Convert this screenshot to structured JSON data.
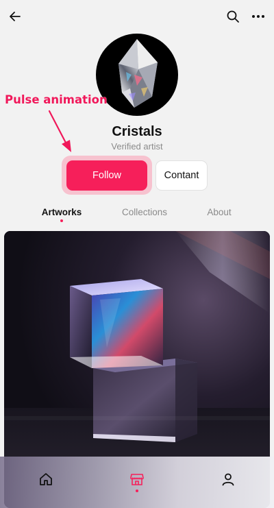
{
  "header": {
    "back_icon": "arrow-left-icon",
    "search_icon": "search-icon",
    "more_icon": "more-horizontal-icon"
  },
  "annotation": {
    "text": "Pulse animation",
    "color": "#f0185a"
  },
  "profile": {
    "name": "Cristals",
    "subtitle": "Verified artist",
    "avatar": "crystal-gem-image"
  },
  "actions": {
    "follow_label": "Follow",
    "contact_label": "Contant",
    "accent_color": "#f61f5a"
  },
  "tabs": [
    {
      "label": "Artworks",
      "active": true
    },
    {
      "label": "Collections",
      "active": false
    },
    {
      "label": "About",
      "active": false
    }
  ],
  "artwork": {
    "image": "prism-cubes-artwork"
  },
  "bottom_nav": {
    "items": [
      {
        "icon": "home-icon",
        "active": false
      },
      {
        "icon": "store-icon",
        "active": true
      },
      {
        "icon": "user-icon",
        "active": false
      }
    ]
  }
}
